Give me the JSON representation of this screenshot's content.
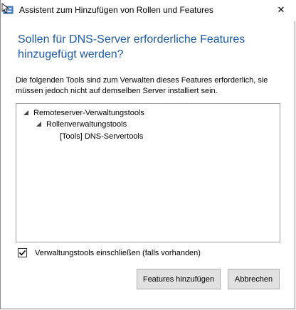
{
  "window": {
    "title": "Assistent zum Hinzufügen von Rollen und Features",
    "close_glyph": "✕"
  },
  "heading": "Sollen für DNS-Server erforderliche Features hinzugefügt werden?",
  "description": "Die folgenden Tools sind zum Verwalten dieses Features erforderlich, sie müssen jedoch nicht auf demselben Server installiert sein.",
  "tree": {
    "items": [
      {
        "label": "Remoteserver-Verwaltungstools",
        "level": 0,
        "expanded": true
      },
      {
        "label": "Rollenverwaltungstools",
        "level": 1,
        "expanded": true
      },
      {
        "label": "[Tools] DNS-Servertools",
        "level": 2,
        "expanded": false
      }
    ]
  },
  "include_tools": {
    "label": "Verwaltungstools einschließen (falls vorhanden)",
    "checked": true
  },
  "buttons": {
    "add": "Features hinzufügen",
    "cancel": "Abbrechen"
  },
  "colors": {
    "heading": "#1e5aa6",
    "button_bg": "#e1e1e1"
  },
  "icons": {
    "app": "server-manager-icon",
    "close": "close-icon",
    "expander": "expanded-triangle-icon",
    "check": "checkmark-icon"
  }
}
